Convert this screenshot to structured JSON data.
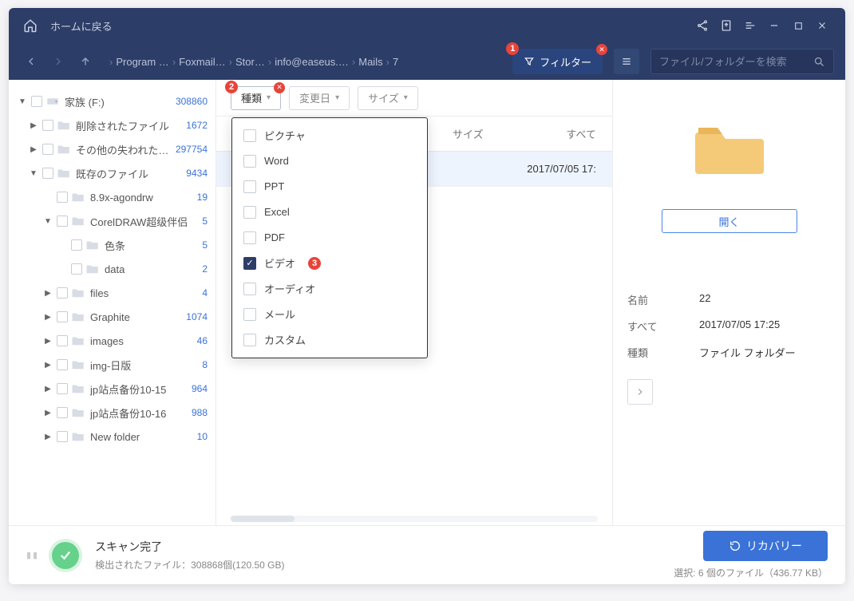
{
  "titlebar": {
    "home_label": "ホームに戻る"
  },
  "nav": {
    "crumbs": [
      "Program …",
      "Foxmail…",
      "Stor…",
      "info@easeus.…",
      "Mails",
      "7"
    ],
    "filter_label": "フィルター",
    "search_placeholder": "ファイル/フォルダーを検索"
  },
  "filters": {
    "type_label": "種類",
    "date_label": "変更日",
    "size_label": "サイズ",
    "type_options": [
      "ピクチャ",
      "Word",
      "PPT",
      "Excel",
      "PDF",
      "ビデオ",
      "オーディオ",
      "メール",
      "カスタム"
    ],
    "type_checked_index": 5
  },
  "badges": {
    "b1": "1",
    "b2": "2",
    "b3": "3"
  },
  "tree": [
    {
      "depth": 0,
      "caret": "▼",
      "label": "家族 (F:)",
      "count": "308860",
      "drive": true
    },
    {
      "depth": 1,
      "caret": "▶",
      "label": "削除されたファイル",
      "count": "1672"
    },
    {
      "depth": 1,
      "caret": "▶",
      "label": "その他の失われたフ…",
      "count": "297754"
    },
    {
      "depth": 1,
      "caret": "▼",
      "label": "既存のファイル",
      "count": "9434"
    },
    {
      "depth": 2,
      "caret": "",
      "label": "8.9x-agondrw",
      "count": "19"
    },
    {
      "depth": 2,
      "caret": "▼",
      "label": "CorelDRAW超级伴侣",
      "count": "5"
    },
    {
      "depth": 3,
      "caret": "",
      "label": "色条",
      "count": "5"
    },
    {
      "depth": 3,
      "caret": "",
      "label": "data",
      "count": "2"
    },
    {
      "depth": 2,
      "caret": "▶",
      "label": "files",
      "count": "4"
    },
    {
      "depth": 2,
      "caret": "▶",
      "label": "Graphite",
      "count": "1074"
    },
    {
      "depth": 2,
      "caret": "▶",
      "label": "images",
      "count": "46"
    },
    {
      "depth": 2,
      "caret": "▶",
      "label": "img-日版",
      "count": "8"
    },
    {
      "depth": 2,
      "caret": "▶",
      "label": "jp站点备份10-15",
      "count": "964"
    },
    {
      "depth": 2,
      "caret": "▶",
      "label": "jp站点备份10-16",
      "count": "988"
    },
    {
      "depth": 2,
      "caret": "▶",
      "label": "New folder",
      "count": "10"
    }
  ],
  "table": {
    "cols": {
      "size": "サイズ",
      "date": "すべて"
    },
    "row_date": "2017/07/05 17:"
  },
  "details": {
    "open_label": "開く",
    "rows": [
      {
        "k": "名前",
        "v": "22"
      },
      {
        "k": "すべて",
        "v": "2017/07/05 17:25"
      },
      {
        "k": "種類",
        "v": "ファイル フォルダー"
      }
    ]
  },
  "footer": {
    "status_title": "スキャン完了",
    "status_sub": "検出されたファイル：308868個(120.50 GB)",
    "recover_label": "リカバリー",
    "selection": "選択: 6 個のファイル（436.77 KB）"
  }
}
